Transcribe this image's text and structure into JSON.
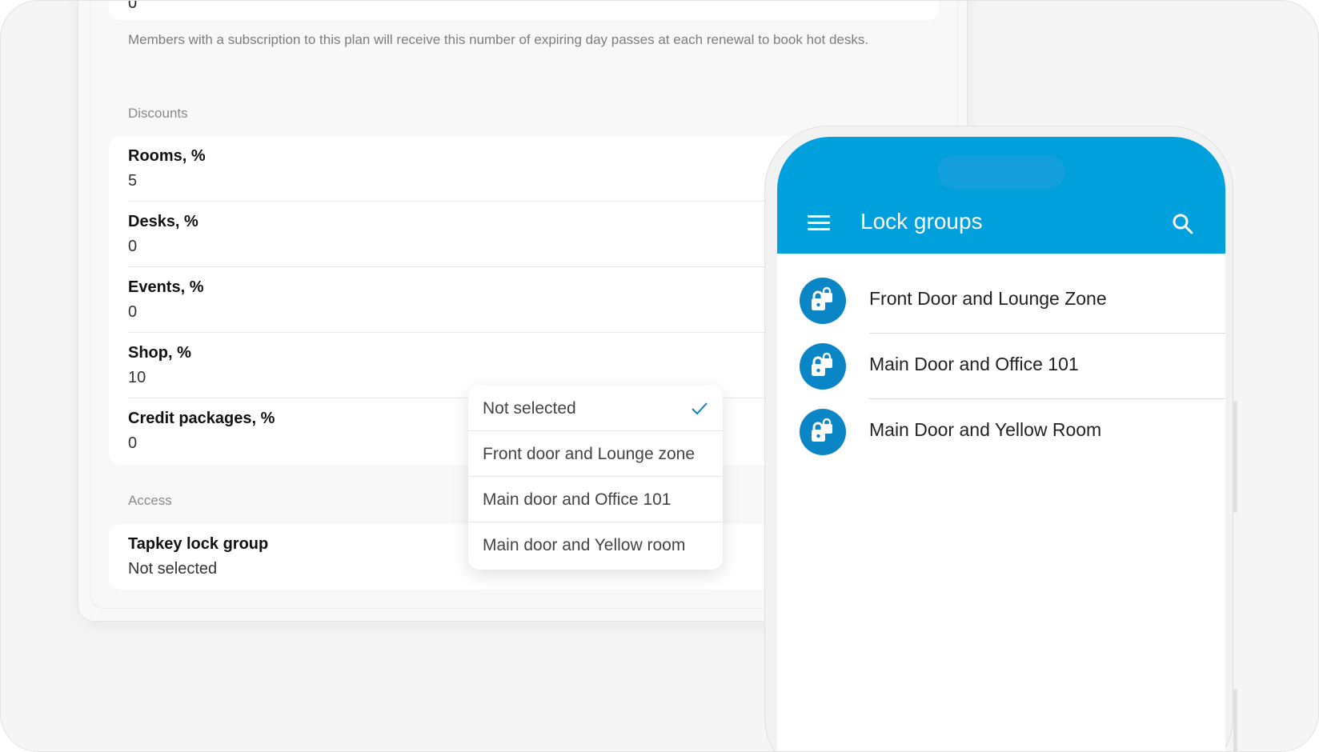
{
  "admin": {
    "top_field_value": "0",
    "helper_text": "Members with a subscription to this plan will receive this number of expiring day passes at each renewal to book hot desks.",
    "discounts_label": "Discounts",
    "discounts": [
      {
        "label": "Rooms, %",
        "value": "5"
      },
      {
        "label": "Desks, %",
        "value": "0"
      },
      {
        "label": "Events, %",
        "value": "0"
      },
      {
        "label": "Shop, %",
        "value": "10"
      },
      {
        "label": "Credit packages, %",
        "value": "0"
      }
    ],
    "access_label": "Access",
    "lock_group": {
      "label": "Tapkey lock group",
      "value": "Not selected"
    }
  },
  "dropdown": {
    "options": [
      "Not selected",
      "Front door and Lounge zone",
      "Main door and Office 101",
      "Main door and Yellow room"
    ],
    "selected": "Not selected"
  },
  "phone": {
    "title": "Lock groups",
    "menu_icon": "hamburger-menu-icon",
    "search_icon": "search-icon",
    "accent_color": "#00a0dc",
    "lock_groups": [
      "Front Door and Lounge Zone",
      "Main Door and Office 101",
      "Main Door and Yellow Room"
    ]
  }
}
